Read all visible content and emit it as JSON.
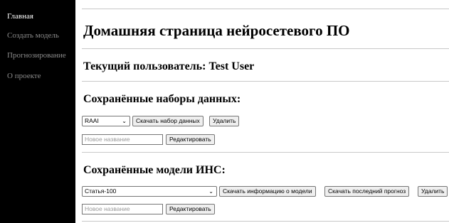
{
  "sidebar": {
    "items": [
      {
        "label": "Главная",
        "active": true
      },
      {
        "label": "Создать модель",
        "active": false
      },
      {
        "label": "Прогнозирование",
        "active": false
      },
      {
        "label": "О проекте",
        "active": false
      }
    ]
  },
  "main": {
    "title": "Домашняя страница нейросетевого ПО",
    "current_user": "Текущий пользователь: Test User",
    "datasets": {
      "heading": "Сохранённые наборы данных:",
      "selected": "RAAI",
      "download_label": "Скачать набор данных",
      "delete_label": "Удалить",
      "rename_placeholder": "Новое название",
      "edit_label": "Редактировать"
    },
    "models": {
      "heading": "Сохранённые модели ИНС:",
      "selected": "Статья-100",
      "download_info_label": "Скачать информацию о модели",
      "download_forecast_label": "Скачать последний прогноз",
      "delete_label": "Удалить",
      "rename_placeholder": "Новое название",
      "edit_label": "Редактировать"
    }
  },
  "colors": {
    "sidebar_bg": "#000000",
    "nav_active": "#ffffff",
    "nav_inactive": "#8c8c8c"
  }
}
